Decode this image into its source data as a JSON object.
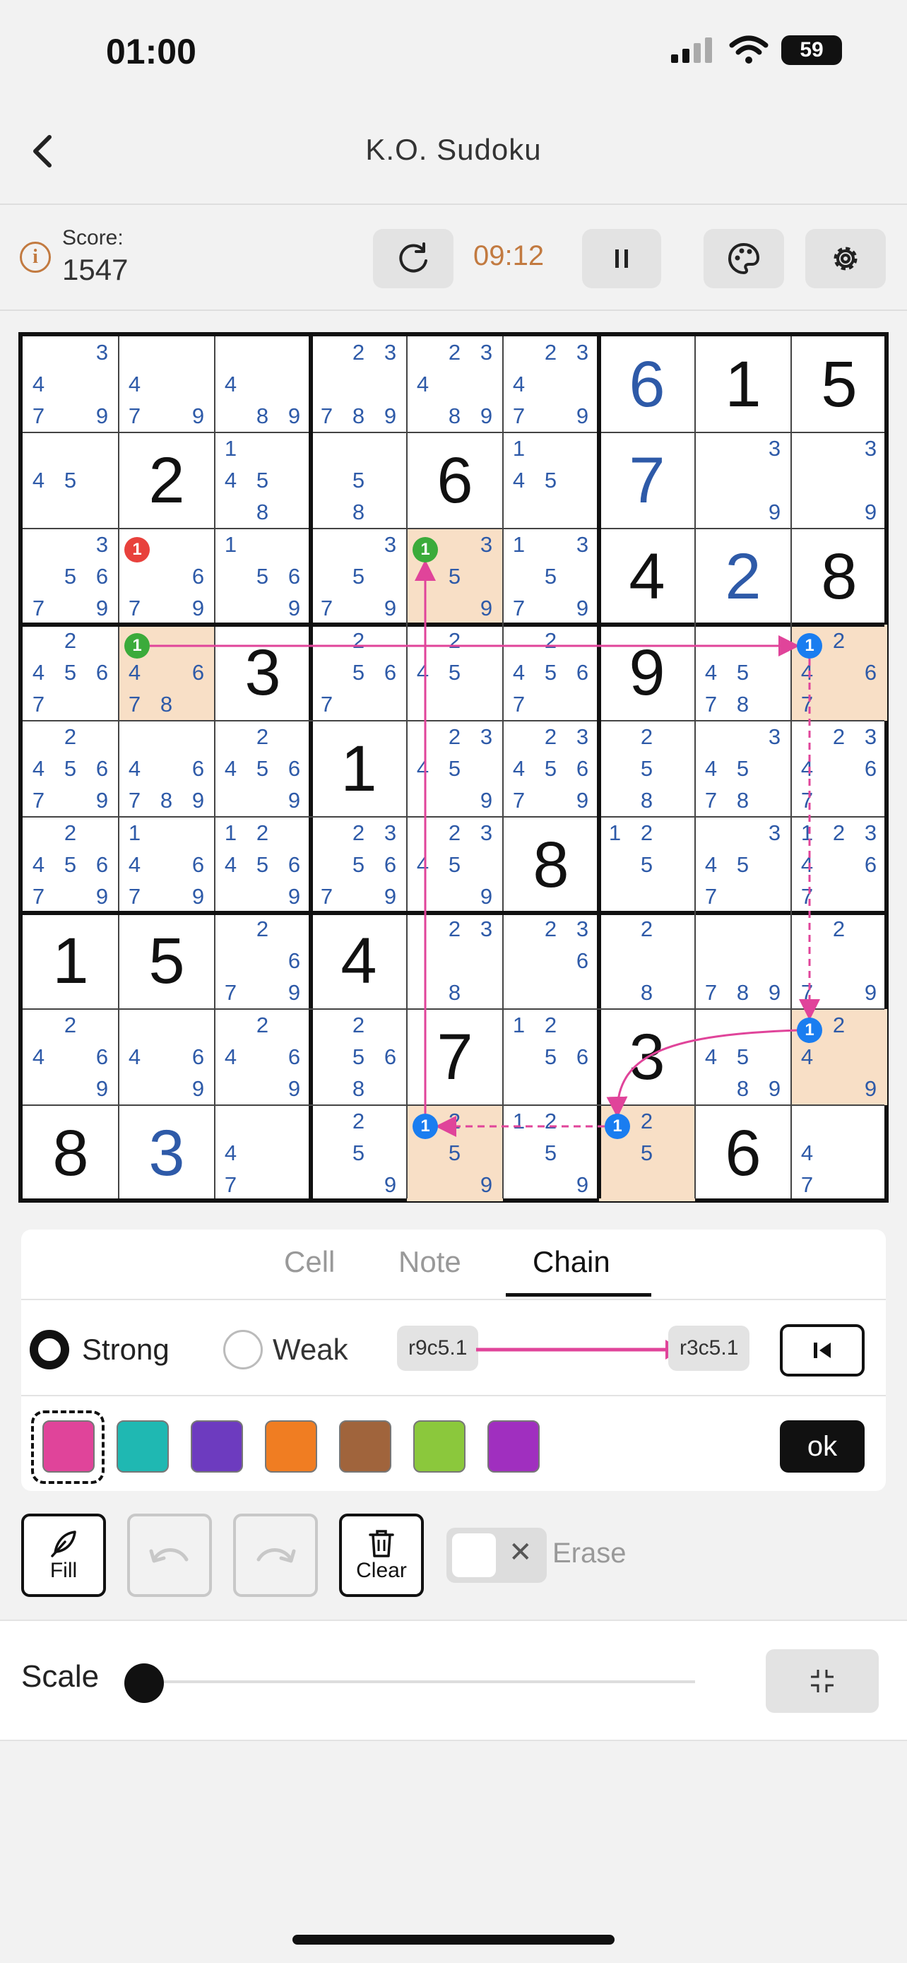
{
  "status_bar": {
    "time": "01:00",
    "battery": "59"
  },
  "nav": {
    "title": "K.O. Sudoku"
  },
  "toolbar": {
    "score_label": "Score:",
    "score": "1547",
    "timer": "09:12"
  },
  "board": {
    "values": [
      [
        0,
        0,
        0,
        0,
        0,
        0,
        6,
        1,
        5
      ],
      [
        0,
        2,
        0,
        0,
        6,
        0,
        7,
        0,
        0
      ],
      [
        0,
        0,
        0,
        0,
        0,
        0,
        4,
        2,
        8
      ],
      [
        0,
        0,
        3,
        0,
        0,
        0,
        9,
        0,
        0
      ],
      [
        0,
        0,
        0,
        1,
        0,
        0,
        0,
        0,
        0
      ],
      [
        0,
        0,
        0,
        0,
        0,
        8,
        0,
        0,
        0
      ],
      [
        1,
        5,
        0,
        4,
        0,
        0,
        0,
        0,
        0
      ],
      [
        0,
        0,
        0,
        0,
        7,
        0,
        3,
        0,
        0
      ],
      [
        8,
        3,
        0,
        0,
        0,
        0,
        0,
        6,
        0
      ]
    ],
    "user_cells": [
      [
        0,
        6
      ],
      [
        1,
        6
      ],
      [
        2,
        7
      ],
      [
        8,
        1
      ]
    ],
    "notes": [
      [
        [
          3,
          4,
          7,
          9
        ],
        [
          4,
          7,
          9
        ],
        [
          4,
          8,
          9
        ],
        [
          2,
          3,
          7,
          8,
          9
        ],
        [
          2,
          3,
          4,
          8,
          9
        ],
        [
          2,
          3,
          4,
          7,
          9
        ],
        [],
        [],
        []
      ],
      [
        [
          4,
          5
        ],
        [],
        [
          1,
          4,
          5,
          8
        ],
        [
          5,
          8
        ],
        [],
        [
          1,
          4,
          5
        ],
        [],
        [
          3,
          9
        ],
        [
          3,
          9
        ]
      ],
      [
        [
          3,
          5,
          6,
          7,
          9
        ],
        [
          6,
          7,
          9
        ],
        [
          1,
          5,
          6,
          9
        ],
        [
          3,
          5,
          7,
          9
        ],
        [
          3,
          5,
          9
        ],
        [
          1,
          3,
          5,
          7,
          9
        ],
        [],
        [],
        []
      ],
      [
        [
          2,
          4,
          5,
          6,
          7
        ],
        [
          4,
          6,
          7,
          8
        ],
        [],
        [
          2,
          5,
          6,
          7
        ],
        [
          2,
          4,
          5
        ],
        [
          2,
          4,
          5,
          6,
          7
        ],
        [],
        [
          4,
          5,
          7,
          8
        ],
        [
          2,
          4,
          6,
          7
        ]
      ],
      [
        [
          2,
          4,
          5,
          6,
          7,
          9
        ],
        [
          4,
          6,
          7,
          8,
          9
        ],
        [
          2,
          4,
          5,
          6,
          9
        ],
        [],
        [
          2,
          3,
          4,
          5,
          9
        ],
        [
          2,
          3,
          4,
          5,
          6,
          7,
          9
        ],
        [
          2,
          5,
          8
        ],
        [
          3,
          4,
          5,
          7,
          8
        ],
        [
          2,
          3,
          4,
          6,
          7
        ]
      ],
      [
        [
          2,
          4,
          5,
          6,
          7,
          9
        ],
        [
          1,
          4,
          6,
          7,
          9
        ],
        [
          1,
          2,
          4,
          5,
          6,
          9
        ],
        [
          2,
          3,
          5,
          6,
          7,
          9
        ],
        [
          2,
          3,
          4,
          5,
          9
        ],
        [],
        [
          1,
          2,
          5
        ],
        [
          3,
          4,
          5,
          7
        ],
        [
          1,
          2,
          3,
          4,
          6,
          7
        ]
      ],
      [
        [],
        [],
        [
          2,
          6,
          7,
          9
        ],
        [],
        [
          2,
          3,
          8
        ],
        [
          2,
          3,
          6
        ],
        [
          2,
          8
        ],
        [
          7,
          8,
          9
        ],
        [
          2,
          7,
          9
        ]
      ],
      [
        [
          2,
          4,
          6,
          9
        ],
        [
          4,
          6,
          9
        ],
        [
          2,
          4,
          6,
          9
        ],
        [
          2,
          5,
          6,
          8
        ],
        [],
        [
          1,
          2,
          5,
          6
        ],
        [],
        [
          4,
          5,
          8,
          9
        ],
        [
          2,
          4,
          9
        ]
      ],
      [
        [],
        [],
        [
          4,
          7
        ],
        [
          2,
          5,
          9
        ],
        [
          2,
          5,
          9
        ],
        [
          1,
          2,
          5,
          9
        ],
        [
          2,
          5
        ],
        [],
        [
          4,
          7
        ]
      ]
    ],
    "highlighted_cells": [
      [
        2,
        4
      ],
      [
        3,
        1
      ],
      [
        3,
        8
      ],
      [
        7,
        8
      ],
      [
        8,
        4
      ],
      [
        8,
        6
      ]
    ],
    "markers": [
      {
        "row": 2,
        "col": 1,
        "label": "1",
        "color": "#e8413c"
      },
      {
        "row": 2,
        "col": 4,
        "label": "1",
        "color": "#3bab3b"
      },
      {
        "row": 3,
        "col": 1,
        "label": "1",
        "color": "#3bab3b"
      },
      {
        "row": 3,
        "col": 8,
        "label": "1",
        "color": "#1a7df0"
      },
      {
        "row": 7,
        "col": 8,
        "label": "1",
        "color": "#1a7df0"
      },
      {
        "row": 8,
        "col": 4,
        "label": "1",
        "color": "#1a7df0"
      },
      {
        "row": 8,
        "col": 6,
        "label": "1",
        "color": "#1a7df0"
      }
    ],
    "chain_color": "#e0449a"
  },
  "panel": {
    "tabs": [
      "Cell",
      "Note",
      "Chain"
    ],
    "active_tab": "Chain",
    "strong_label": "Strong",
    "weak_label": "Weak",
    "link_from": "r9c5.1",
    "link_to": "r3c5.1",
    "ok_label": "ok",
    "swatches": [
      "#e0449a",
      "#1fb8b2",
      "#6d3bbf",
      "#f07d22",
      "#a0643c",
      "#8bc83c",
      "#a02fbf"
    ]
  },
  "actions": {
    "fill_label": "Fill",
    "clear_label": "Clear",
    "erase_label": "Erase"
  },
  "scale": {
    "label": "Scale"
  }
}
